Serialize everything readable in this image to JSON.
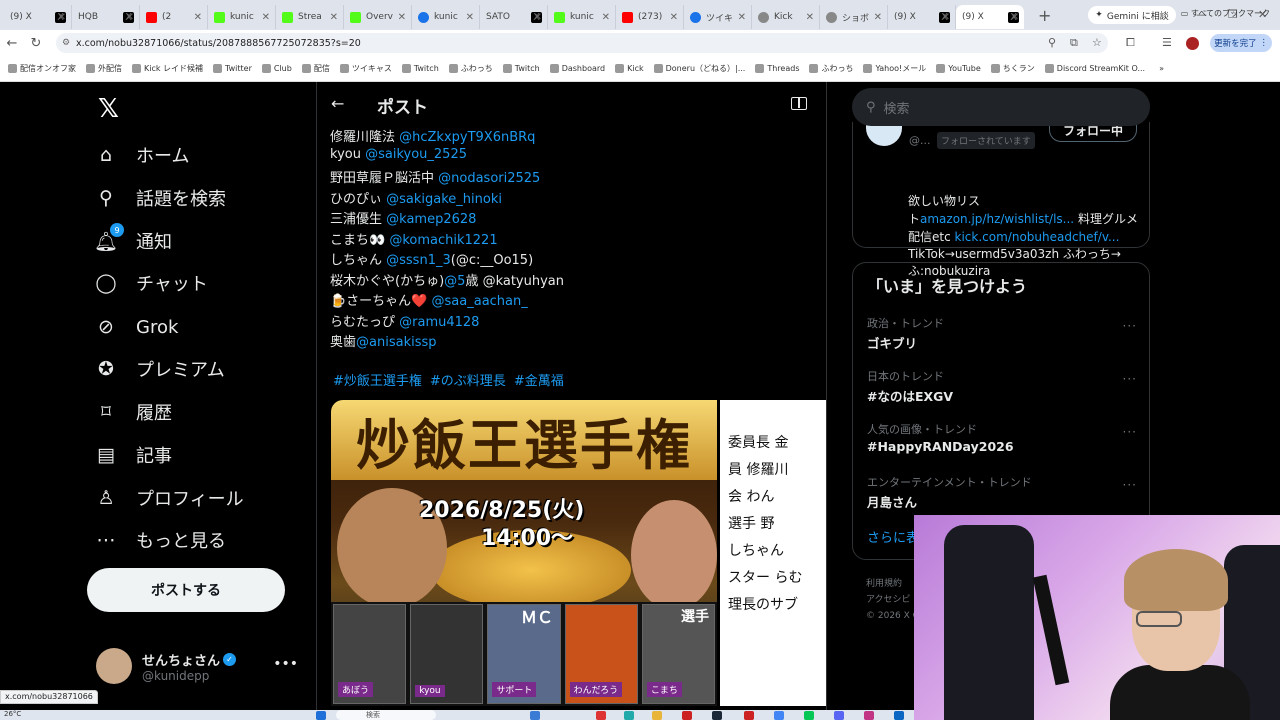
{
  "browser": {
    "tabs": [
      {
        "label": "(9) X",
        "icon": "x-icon",
        "style": "x"
      },
      {
        "label": "HQB",
        "icon": "x-icon",
        "style": "x"
      },
      {
        "label": "(2",
        "icon": "youtube-icon",
        "style": "red"
      },
      {
        "label": "kunic",
        "icon": "kick-icon",
        "style": "green"
      },
      {
        "label": "Strea",
        "icon": "kick-icon",
        "style": "green"
      },
      {
        "label": "Overv",
        "icon": "kick-icon",
        "style": "green"
      },
      {
        "label": "kunic",
        "icon": "globe-icon",
        "style": "blue"
      },
      {
        "label": "SATO",
        "icon": "globe-icon",
        "style": "x"
      },
      {
        "label": "kunic",
        "icon": "kick-icon",
        "style": "green"
      },
      {
        "label": "(273)",
        "icon": "youtube-icon",
        "style": "red"
      },
      {
        "label": "ツイキ",
        "icon": "globe-icon",
        "style": "blue"
      },
      {
        "label": "Kick",
        "icon": "globe-icon",
        "style": "gray"
      },
      {
        "label": "ショボ",
        "icon": "globe-icon",
        "style": "gray"
      },
      {
        "label": "(9) X",
        "icon": "x-icon",
        "style": "x"
      },
      {
        "label": "(9) X",
        "icon": "x-icon",
        "style": "x",
        "active": true
      }
    ],
    "gemini_label": "Gemini に相談",
    "url": "x.com/nobu32871066/status/2087888567725072835?s=20",
    "update_label": "更新を完了",
    "bookmarks": [
      "配信オンオフ家",
      "外配信",
      "Kick レイド候補",
      "Twitter",
      "Club",
      "配信",
      "ツイキャス",
      "Twitch",
      "ふわっち",
      "Twitch",
      "Dashboard",
      "Kick",
      "Doneru（どねる）|...",
      "Threads",
      "ふわっち",
      "Yahoo!メール",
      "YouTube",
      "ちくラン",
      "Discord StreamKit O..."
    ],
    "all_bookmarks": "すべてのブックマーク",
    "status_url": "x.com/nobu32871066"
  },
  "nav": {
    "items": [
      {
        "label": "ホーム",
        "icon": "home-icon",
        "glyph": "⌂"
      },
      {
        "label": "話題を検索",
        "icon": "search-icon",
        "glyph": "⚲"
      },
      {
        "label": "通知",
        "icon": "bell-icon",
        "glyph": "🔔︎",
        "badge": "9"
      },
      {
        "label": "チャット",
        "icon": "chat-icon",
        "glyph": "◯"
      },
      {
        "label": "Grok",
        "icon": "grok-icon",
        "glyph": "⊘"
      },
      {
        "label": "プレミアム",
        "icon": "premium-icon",
        "glyph": "✪"
      },
      {
        "label": "履歴",
        "icon": "bookmark-icon",
        "glyph": "⌑"
      },
      {
        "label": "記事",
        "icon": "article-icon",
        "glyph": "▤"
      },
      {
        "label": "プロフィール",
        "icon": "person-icon",
        "glyph": "♙"
      },
      {
        "label": "もっと見る",
        "icon": "more-circle-icon",
        "glyph": "⋯"
      }
    ],
    "post_button": "ポストする",
    "user": {
      "name": "せんちょさん",
      "handle": "@kunidepp"
    }
  },
  "post": {
    "header_title": "ポスト",
    "lines": [
      {
        "name": "修羅川隆法 ",
        "mention": "@hcZkxpyT9X6nBRq",
        "after": ""
      },
      {
        "name": "kyou ",
        "mention": "@saikyou_2525",
        "after": ""
      },
      {
        "name": "野田草履Ｐ脳活中 ",
        "mention": "@nodasori2525",
        "after": ""
      },
      {
        "name": "ひのぴぃ ",
        "mention": "@sakigake_hinoki",
        "after": ""
      },
      {
        "name": "三浦優生 ",
        "mention": "@kamep2628",
        "after": ""
      },
      {
        "name": "こまち👀 ",
        "mention": "@komachik1221",
        "after": ""
      },
      {
        "name": "しちゃん ",
        "mention": "@sssn1_3",
        "after": "(@c:__Oo15)"
      },
      {
        "name": "桜木かぐや(かちゅ)",
        "mention": "@5",
        "after": "歳 @katyuhyan"
      },
      {
        "name": "🍺さーちゃん❤️ ",
        "mention": "@saa_aachan_",
        "after": ""
      },
      {
        "name": "らむたっぴ ",
        "mention": "@ramu4128",
        "after": ""
      },
      {
        "name": "奥歯",
        "mention": "@anisakissp",
        "after": ""
      }
    ],
    "hashtags": [
      "#炒飯王選手権",
      "#のぶ料理長",
      "#金萬福"
    ],
    "image1": {
      "banner": "炒飯王選手権",
      "date": "2026/8/25(火)",
      "time": "14:00〜",
      "mc": "ＭＣ",
      "player": "選手",
      "cells": [
        "あぼう",
        "kyou",
        "サポート",
        "わんだろう",
        "こまち"
      ]
    },
    "image2_lines": [
      "委員長 金",
      "員 修羅川",
      "会 わん",
      "選手 野",
      "しちゃん",
      "スター らむ",
      "理長のサブ"
    ]
  },
  "right": {
    "search_placeholder": "検索",
    "profile_card": {
      "handle": "@...",
      "follows_you": "フォローされています",
      "follow_button": "フォロー中",
      "bio_1": "欲しい物リス",
      "bio_2a": "ト",
      "bio_2link": "amazon.jp/hz/wishlist/ls...",
      "bio_2b": " 料理グルメ",
      "bio_3a": "配信etc ",
      "bio_3link": "kick.com/nobuheadchef/v...",
      "bio_4": "TikTok→usermd5v3a03zh ふわっち→",
      "bio_5": "ふ:nobukuzira"
    },
    "trends_title": "「いま」を見つけよう",
    "trends": [
      {
        "category": "政治・トレンド",
        "title": "ゴキブリ"
      },
      {
        "category": "日本のトレンド",
        "title": "#なのはEXGV"
      },
      {
        "category": "人気の画像・トレンド",
        "title": "#HappyRANDay2026"
      },
      {
        "category": "エンターテインメント・トレンド",
        "title": "月島さん"
      }
    ],
    "show_more": "さらに表",
    "footer_1": "利用規約",
    "footer_2": "アクセシビ",
    "footer_3": "© 2026 X C"
  },
  "taskbar": {
    "weather": "26°C",
    "search": "検索"
  }
}
